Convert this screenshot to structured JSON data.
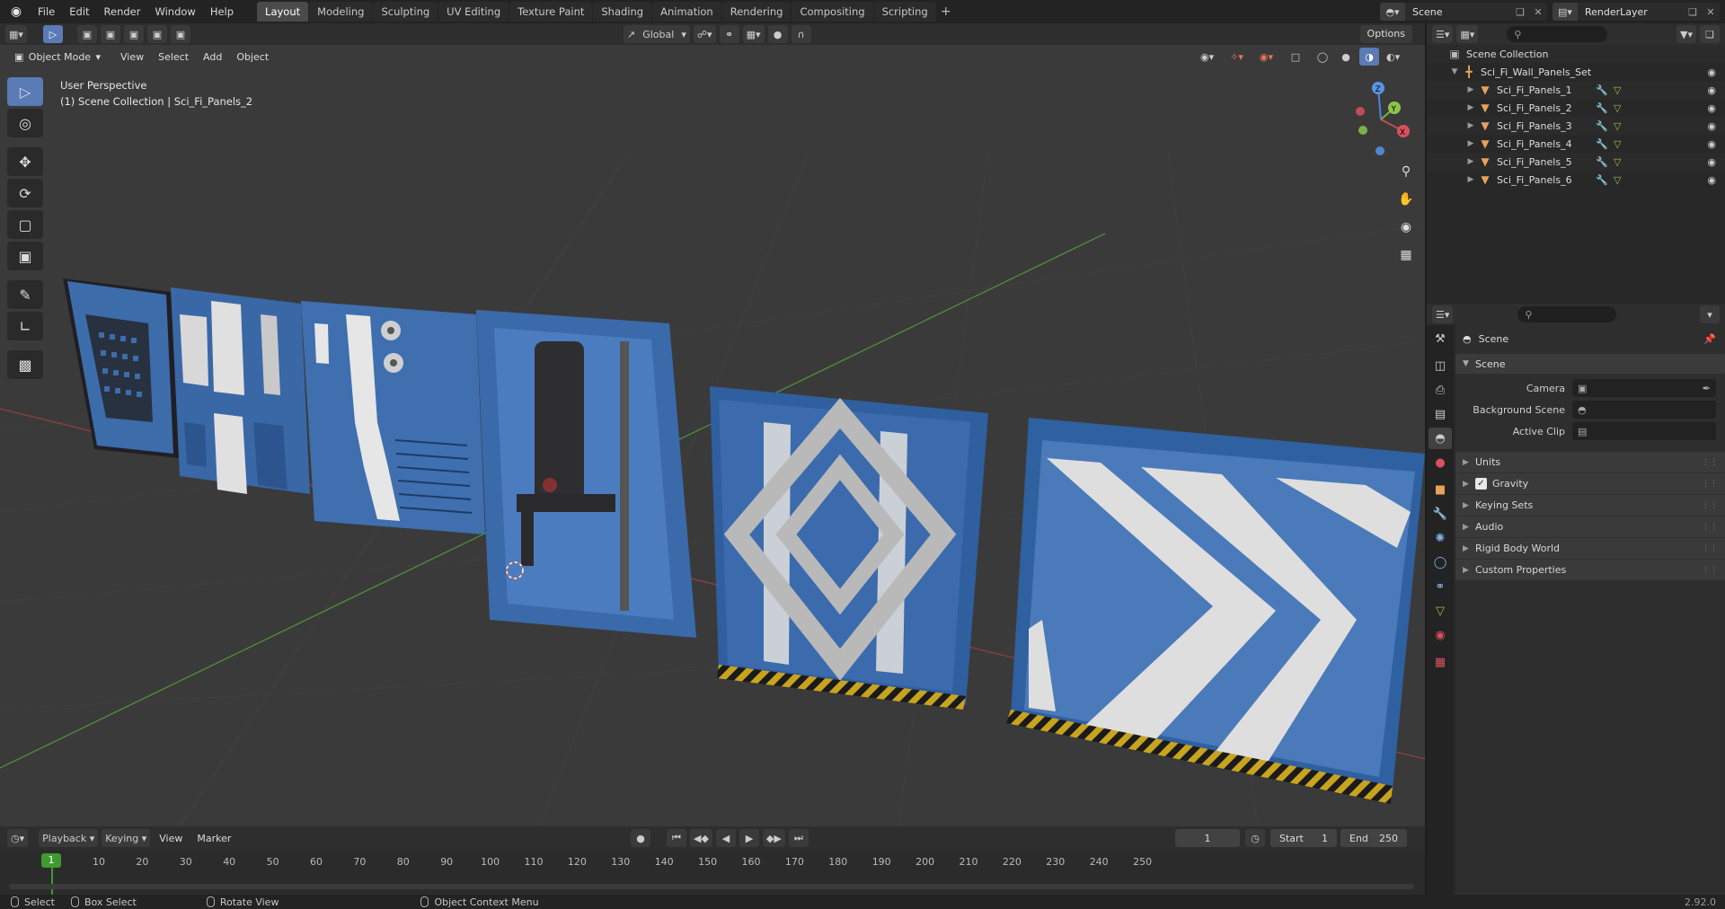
{
  "app": {
    "menu": [
      "File",
      "Edit",
      "Render",
      "Window",
      "Help"
    ],
    "workspaces": [
      "Layout",
      "Modeling",
      "Sculpting",
      "UV Editing",
      "Texture Paint",
      "Shading",
      "Animation",
      "Rendering",
      "Compositing",
      "Scripting"
    ],
    "active_workspace": "Layout",
    "scene_name": "Scene",
    "view_layer": "RenderLayer"
  },
  "viewport": {
    "mode": "Object Mode",
    "menus": [
      "View",
      "Select",
      "Add",
      "Object"
    ],
    "transform_orientation": "Global",
    "options_label": "Options",
    "info_line1": "User Perspective",
    "info_line2": "(1) Scene Collection | Sci_Fi_Panels_2",
    "gizmo_axes": {
      "x": "X",
      "y": "Y",
      "z": "Z"
    }
  },
  "timeline": {
    "menus": [
      "Playback",
      "Keying",
      "View",
      "Marker"
    ],
    "current_frame": "1",
    "start_label": "Start",
    "start": "1",
    "end_label": "End",
    "end": "250",
    "ticks": [
      "10",
      "20",
      "30",
      "40",
      "50",
      "60",
      "70",
      "80",
      "90",
      "100",
      "110",
      "120",
      "130",
      "140",
      "150",
      "160",
      "170",
      "180",
      "190",
      "200",
      "210",
      "220",
      "230",
      "240",
      "250"
    ],
    "current_marker": "1"
  },
  "statusbar": {
    "select": "Select",
    "box_select": "Box Select",
    "rotate_view": "Rotate View",
    "context_menu": "Object Context Menu",
    "version": "2.92.0"
  },
  "outliner": {
    "root": "Scene Collection",
    "collection": "Sci_Fi_Wall_Panels_Set",
    "objects": [
      "Sci_Fi_Panels_1",
      "Sci_Fi_Panels_2",
      "Sci_Fi_Panels_3",
      "Sci_Fi_Panels_4",
      "Sci_Fi_Panels_5",
      "Sci_Fi_Panels_6"
    ]
  },
  "properties": {
    "context": "Scene",
    "panel_title": "Scene",
    "camera_label": "Camera",
    "background_scene_label": "Background Scene",
    "active_clip_label": "Active Clip",
    "subpanels": [
      "Units",
      "Gravity",
      "Keying Sets",
      "Audio",
      "Rigid Body World",
      "Custom Properties"
    ],
    "gravity_checked": true
  },
  "colors": {
    "accent": "#5a7bb5",
    "frame_green": "#3f9a2f",
    "panel_blue": "#3f6fae",
    "stripe_white": "#d8d8d8"
  }
}
